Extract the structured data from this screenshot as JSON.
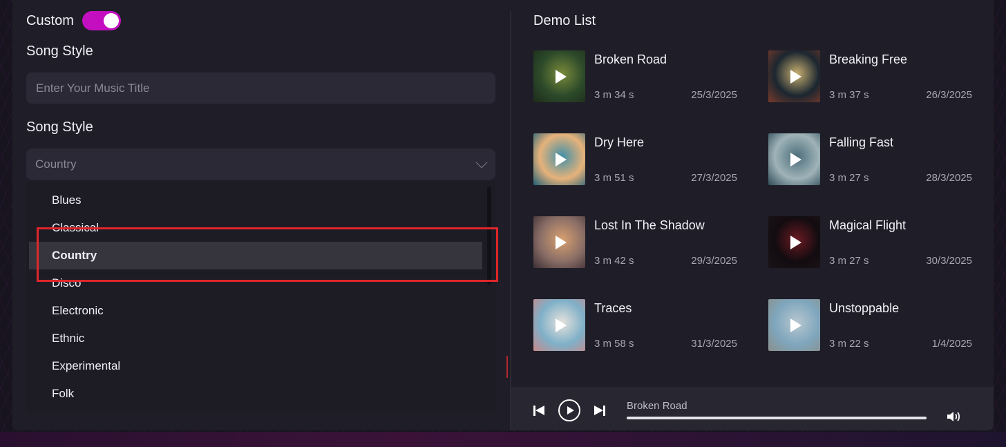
{
  "left": {
    "custom_label": "Custom",
    "custom_enabled": true,
    "section1_title": "Song Style",
    "title_input": {
      "placeholder": "Enter Your Music Title",
      "value": ""
    },
    "section2_title": "Song Style",
    "style_select": {
      "value": "Country"
    },
    "style_options": [
      "Blues",
      "Classical",
      "Country",
      "Disco",
      "Electronic",
      "Ethnic",
      "Experimental",
      "Folk"
    ],
    "selected_option": "Country"
  },
  "right": {
    "demo_title": "Demo List",
    "songs": [
      {
        "title": "Broken Road",
        "duration": "3 m 34 s",
        "date": "25/3/2025",
        "thumb_colors": [
          "#2c4a2a",
          "#7a8a3a",
          "#1d2b1a"
        ]
      },
      {
        "title": "Breaking Free",
        "duration": "3 m 37 s",
        "date": "26/3/2025",
        "thumb_colors": [
          "#1b2630",
          "#c9b070",
          "#7a3a2a"
        ]
      },
      {
        "title": "Dry Here",
        "duration": "3 m 51 s",
        "date": "27/3/2025",
        "thumb_colors": [
          "#e6b27a",
          "#3f8fa8",
          "#1f5f78"
        ]
      },
      {
        "title": "Falling Fast",
        "duration": "3 m 27 s",
        "date": "28/3/2025",
        "thumb_colors": [
          "#9fb3b8",
          "#4c6d7a",
          "#2d4a56"
        ]
      },
      {
        "title": "Lost In The Shadow",
        "duration": "3 m 42 s",
        "date": "29/3/2025",
        "thumb_colors": [
          "#8a6e66",
          "#d8a070",
          "#3c2e34"
        ]
      },
      {
        "title": "Magical Flight",
        "duration": "3 m 27 s",
        "date": "30/3/2025",
        "thumb_colors": [
          "#120c10",
          "#6a1a22",
          "#1a1418"
        ]
      },
      {
        "title": "Traces",
        "duration": "3 m 58 s",
        "date": "31/3/2025",
        "thumb_colors": [
          "#7fb0c8",
          "#e6e2dc",
          "#c98a8a"
        ]
      },
      {
        "title": "Unstoppable",
        "duration": "3 m 22 s",
        "date": "1/4/2025",
        "thumb_colors": [
          "#7fa6bd",
          "#b7c7cf",
          "#8a8f8a"
        ]
      }
    ]
  },
  "player": {
    "now_playing": "Broken Road",
    "progress": 1.0
  },
  "colors": {
    "accent": "#c40fc0",
    "highlight_box": "#e0262a"
  }
}
